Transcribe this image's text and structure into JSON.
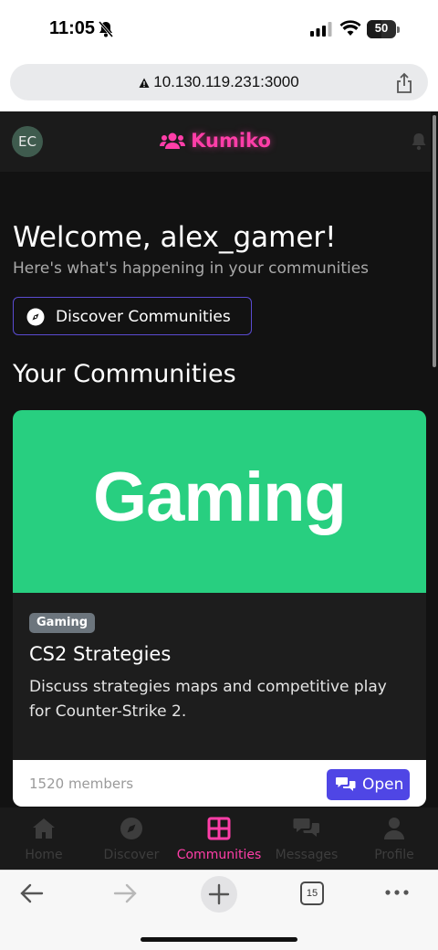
{
  "status_bar": {
    "time": "11:05",
    "battery": "50",
    "battery_level": 0.5
  },
  "browser": {
    "url": "10.130.119.231:3000",
    "tab_count": "15"
  },
  "header": {
    "avatar_initials": "EC",
    "brand": "Kumiko"
  },
  "main": {
    "welcome": "Welcome, alex_gamer!",
    "subtitle": "Here's what's happening in your communities",
    "discover_button": "Discover Communities",
    "section_title": "Your Communities"
  },
  "community_card": {
    "banner_text": "Gaming",
    "banner_color": "#28cf80",
    "category": "Gaming",
    "title": "CS2 Strategies",
    "description": "Discuss strategies maps and competitive play for Counter-Strike 2.",
    "members": "1520 members",
    "open_button": "Open"
  },
  "bottom_nav": {
    "items": [
      {
        "label": "Home",
        "icon": "home-icon"
      },
      {
        "label": "Discover",
        "icon": "compass-icon"
      },
      {
        "label": "Communities",
        "icon": "grid-icon",
        "active": true
      },
      {
        "label": "Messages",
        "icon": "chat-icon"
      },
      {
        "label": "Profile",
        "icon": "user-icon"
      }
    ]
  },
  "colors": {
    "accent": "#ff3ea8",
    "primary_button": "#4f46e5",
    "background": "#121212"
  }
}
